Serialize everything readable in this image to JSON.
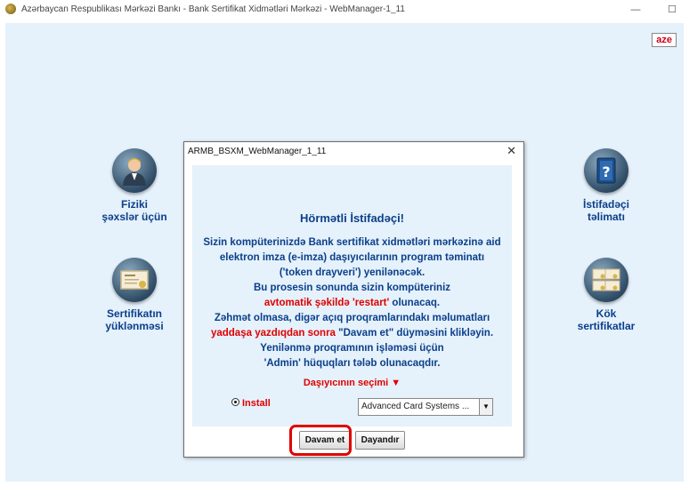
{
  "window": {
    "title": "Azərbaycan Respublikası Mərkəzi Bankı - Bank Sertifikat Xidmətləri Mərkəzi - WebManager-1_11",
    "minimize": "—",
    "maximize": "☐"
  },
  "language": "aze",
  "left_menu": [
    {
      "line1": "Fiziki",
      "line2": "şəxslər üçün",
      "icon": "person-icon"
    },
    {
      "line1": "Sertifikatın",
      "line2": "yüklənməsi",
      "icon": "certificate-icon"
    }
  ],
  "right_menu": [
    {
      "line1": "İstifadəçi",
      "line2": "təlimatı",
      "icon": "help-book-icon"
    },
    {
      "line1": "Kök",
      "line2": "sertifikatlar",
      "icon": "root-certificates-icon"
    }
  ],
  "dialog": {
    "title": "ARMB_BSXM_WebManager_1_11",
    "close": "✕",
    "greeting": "Hörmətli İstifadəçi!",
    "lines": [
      "Sizin kompüterinizdə Bank sertifikat xidmətləri mərkəzinə aid",
      "elektron imza (e-imza) daşıyıcılarının program təminatı",
      "('token drayveri') yenilənəcək.",
      "Bu prosesin sonunda sizin kompüteriniz"
    ],
    "line5_red": "avtomatik şəkildə 'restart'",
    "line5_rest": " olunacaq.",
    "line6": "Zəhmət olmasa, digər açıq proqramlarındakı məlumatları",
    "line7_red": "yaddaşa yazdıqdan sonra",
    "line7_rest": " \"Davam et\" düyməsini klikləyin.",
    "line8": "Yenilənmə proqramının işləməsi üçün",
    "line9": "'Admin' hüquqları tələb olunacaqdır.",
    "carrier_label": "Daşıyıcının seçimi ▼",
    "install_label": "Install",
    "combo_value": "Advanced Card Systems ...",
    "combo_arrow": "▼",
    "continue_button": "Davam et",
    "cancel_button": "Dayandır"
  },
  "colors": {
    "accent_blue": "#0b3f8a",
    "warning_red": "#e00000",
    "background": "#e5f1fb"
  }
}
